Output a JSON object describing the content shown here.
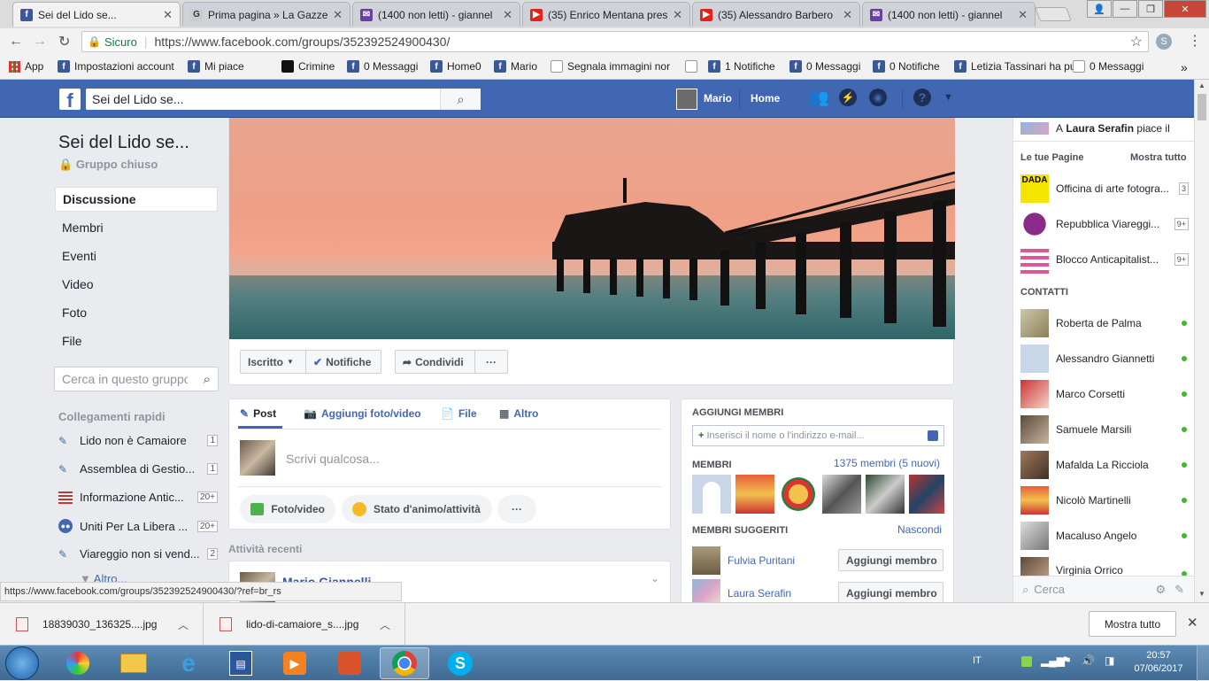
{
  "browser": {
    "tabs": [
      {
        "title": "Sei del Lido se...",
        "icon": "facebook-icon",
        "active": true
      },
      {
        "title": "Prima pagina » La Gazze",
        "icon": "gazzetta-icon"
      },
      {
        "title": "(1400 non letti) - giannel",
        "icon": "yahoo-mail-icon"
      },
      {
        "title": "(35) Enrico Mentana pres",
        "icon": "youtube-icon"
      },
      {
        "title": "(35) Alessandro Barbero",
        "icon": "youtube-icon"
      },
      {
        "title": "(1400 non letti) - giannel",
        "icon": "yahoo-mail-icon"
      }
    ],
    "secure_label": "Sicuro",
    "url": "https://www.facebook.com/groups/352392524900430/",
    "bookmarks": [
      "App",
      "Impostazioni account",
      "Mi piace",
      "Crimine",
      "0 Messaggi",
      "Home0",
      "Mario",
      "Segnala immagini nor",
      "1 Notifiche",
      "0 Messaggi",
      "0 Notifiche",
      "Letizia Tassinari ha pu",
      "0 Messaggi"
    ],
    "bookmarks_more": "»"
  },
  "fb_header": {
    "search_value": "Sei del Lido se...",
    "user_name": "Mario",
    "home_label": "Home"
  },
  "group": {
    "name": "Sei del Lido se...",
    "privacy": "Gruppo chiuso",
    "nav": [
      "Discussione",
      "Membri",
      "Eventi",
      "Video",
      "Foto",
      "File"
    ],
    "search_placeholder": "Cerca in questo gruppo",
    "quick_links_title": "Collegamenti rapidi",
    "quick_links": [
      {
        "label": "Lido non è Camaiore",
        "count": "1"
      },
      {
        "label": "Assemblea di Gestio...",
        "count": "1"
      },
      {
        "label": "Informazione Antic...",
        "count": "20+"
      },
      {
        "label": "Uniti Per La Libera ...",
        "count": "20+"
      },
      {
        "label": "Viareggio non si vend...",
        "count": "2"
      }
    ],
    "more_label": "Altro..."
  },
  "cover_actions": {
    "joined": "Iscritto",
    "notifications": "Notifiche",
    "share": "Condividi",
    "more": "···"
  },
  "composer": {
    "tabs": [
      "Post",
      "Aggiungi foto/video",
      "File",
      "Altro"
    ],
    "placeholder": "Scrivi qualcosa...",
    "buttons": [
      "Foto/video",
      "Stato d'animo/attività"
    ],
    "more": "···"
  },
  "recent": {
    "title": "Attività recenti",
    "first_author": "Mario Giannelli"
  },
  "add_members": {
    "title": "AGGIUNGI MEMBRI",
    "placeholder": "Inserisci il nome o l'indirizzo e-mail...",
    "members_label": "MEMBRI",
    "members_count": "1375 membri (5 nuovi)",
    "suggested_label": "MEMBRI SUGGERITI",
    "hide_label": "Nascondi",
    "suggested": [
      {
        "name": "Fulvia Puritani",
        "button": "Aggiungi membro"
      },
      {
        "name": "Laura Serafin",
        "button": "Aggiungi membro"
      }
    ]
  },
  "sidebar": {
    "ticker_prefix": "A",
    "ticker_name": "Laura Serafin",
    "ticker_suffix": "piace il",
    "pages_title": "Le tue Pagine",
    "show_all": "Mostra tutto",
    "pages": [
      {
        "name": "Officina di arte fotogra...",
        "badge": "3"
      },
      {
        "name": "Repubblica Viareggi...",
        "badge": "9+"
      },
      {
        "name": "Blocco Anticapitalist...",
        "badge": "9+"
      }
    ],
    "contacts_title": "CONTATTI",
    "contacts": [
      "Roberta de Palma",
      "Alessandro Giannetti",
      "Marco Corsetti",
      "Samuele Marsili",
      "Mafalda La Ricciola",
      "Nicolò Martinelli",
      "Macaluso Angelo",
      "Virginia Orrico"
    ],
    "chat_search_placeholder": "Cerca"
  },
  "status_link": "https://www.facebook.com/groups/352392524900430/?ref=br_rs",
  "downloads": {
    "items": [
      "18839030_136325....jpg",
      "lido-di-camaiore_s....jpg"
    ],
    "show_all": "Mostra tutto"
  },
  "taskbar": {
    "lang": "IT",
    "time": "20:57",
    "date": "07/06/2017"
  }
}
